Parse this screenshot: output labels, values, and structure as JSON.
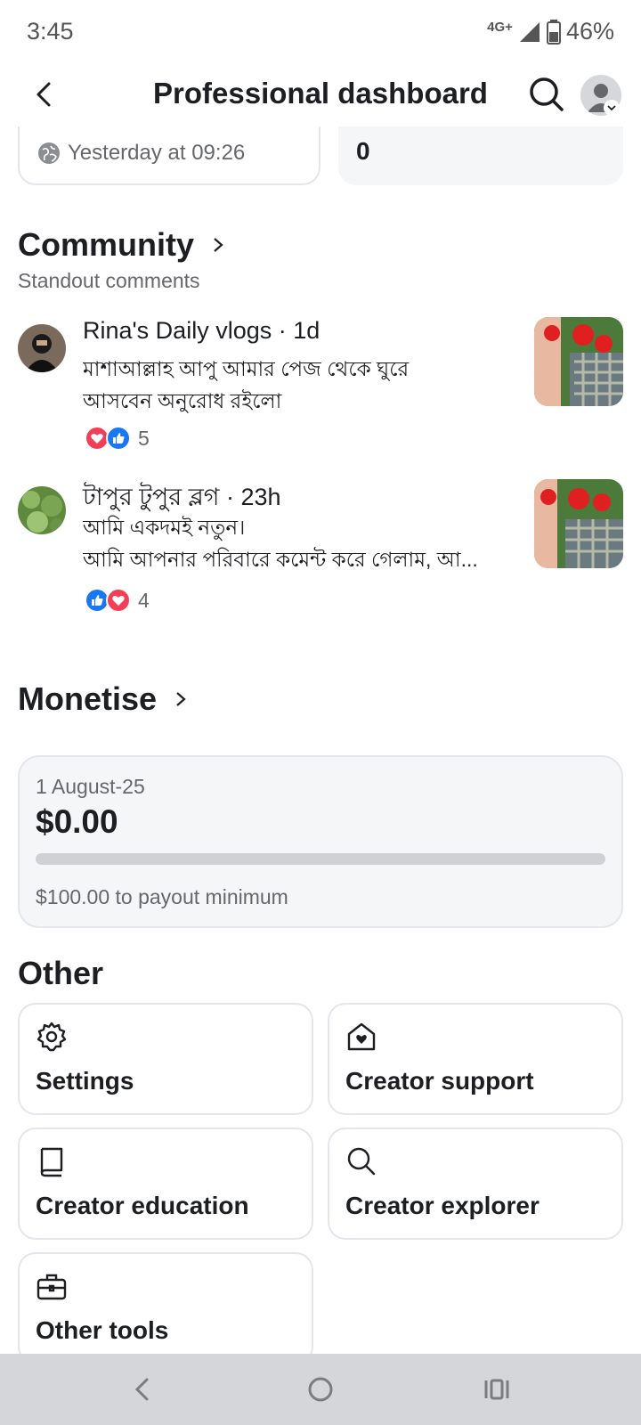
{
  "status": {
    "time": "3:45",
    "network": "4G+",
    "battery": "46%"
  },
  "header": {
    "title": "Professional dashboard"
  },
  "stats": {
    "timestamp": "Yesterday at 09:26",
    "value": "0"
  },
  "community": {
    "title": "Community",
    "subtitle": "Standout comments",
    "comments": [
      {
        "author": "Rina's Daily vlogs · 1d",
        "lines": [
          "মাশাআল্লাহ আপু আমার পেজ থেকে ঘুরে",
          "আসবেন অনুরোধ রইলো"
        ],
        "reaction_count": "5",
        "reactions": [
          "love",
          "like"
        ]
      },
      {
        "author": "টাপুর টুপুর ব্লগ · 23h",
        "lines": [
          "আমি একদমই নতুন।",
          "আমি আপনার পরিবারে কমেন্ট করে গেলাম, আ..."
        ],
        "reaction_count": "4",
        "reactions": [
          "like",
          "love"
        ]
      }
    ]
  },
  "monetise": {
    "title": "Monetise",
    "date": "1 August-25",
    "amount": "$0.00",
    "progress": 0,
    "note": "$100.00 to payout minimum"
  },
  "other": {
    "title": "Other",
    "tools": [
      {
        "label": "Settings",
        "icon": "gear-icon"
      },
      {
        "label": "Creator support",
        "icon": "house-heart-icon"
      },
      {
        "label": "Creator education",
        "icon": "book-icon"
      },
      {
        "label": "Creator explorer",
        "icon": "search-icon"
      },
      {
        "label": "Other tools",
        "icon": "toolbox-icon"
      }
    ]
  },
  "colors": {
    "accent": "#1877f2",
    "love": "#f33e58",
    "muted": "#65676b",
    "card_border": "#e4e6eb",
    "card_bg": "#f5f6f7"
  }
}
